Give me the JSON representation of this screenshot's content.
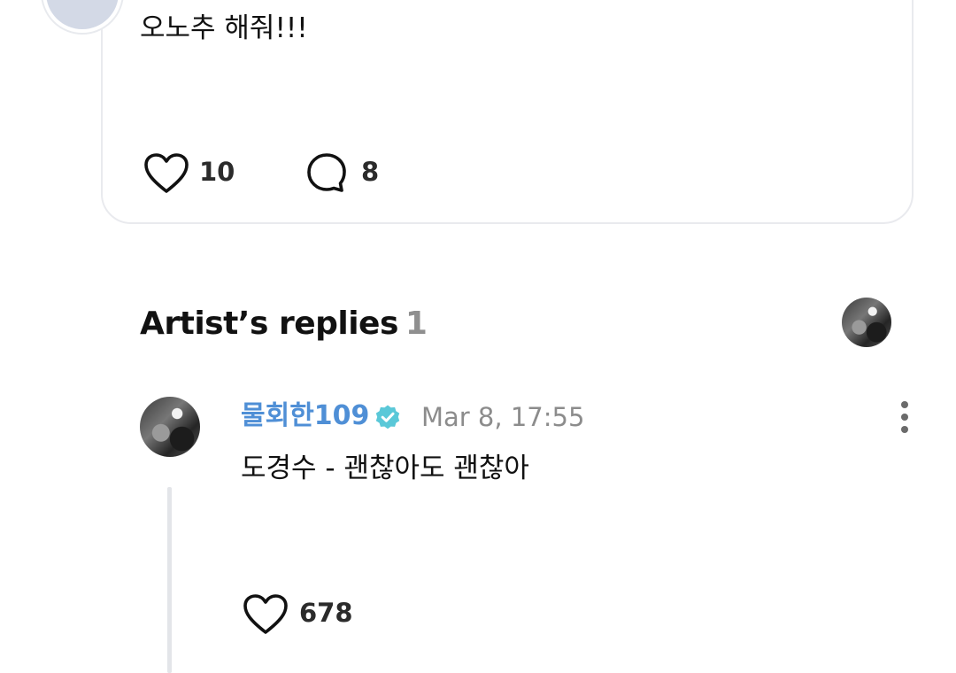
{
  "post": {
    "text": "오노추 해줘!!!",
    "likes": "10",
    "comments": "8"
  },
  "artist_replies": {
    "title": "Artist’s replies",
    "count": "1"
  },
  "reply": {
    "author": "물회한109",
    "timestamp": "Mar 8, 17:55",
    "text": "도경수 - 괜찮아도 괜찮아",
    "likes": "678"
  },
  "icons": {
    "like": "heart-outline-icon",
    "comment": "speech-bubble-icon",
    "verified": "verified-badge-icon",
    "more": "more-vertical-icon"
  },
  "colors": {
    "author_name": "#4f8fd6",
    "verified_badge": "#5ac8d8",
    "muted_text": "#8c8c8c",
    "card_border": "#e9eaee"
  }
}
